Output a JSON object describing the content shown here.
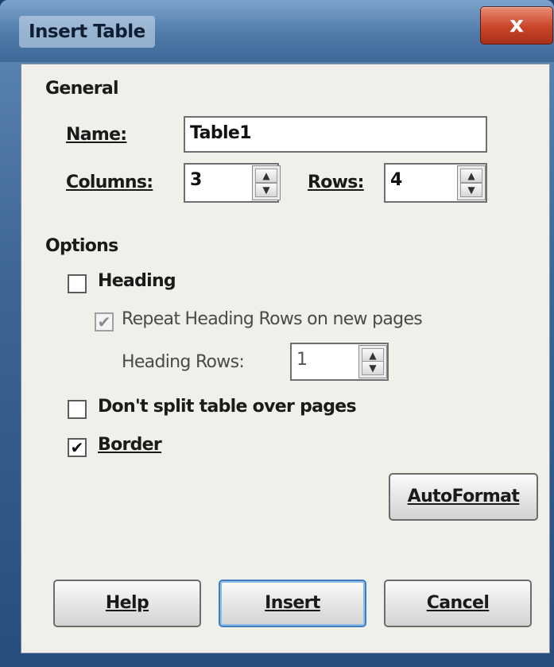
{
  "window": {
    "title": "Insert Table",
    "close_glyph": "x"
  },
  "general": {
    "heading": "General",
    "name_label": "Name:",
    "name_value": "Table1",
    "columns_label": "Columns:",
    "columns_value": "3",
    "rows_label": "Rows:",
    "rows_value": "4"
  },
  "options": {
    "heading": "Options",
    "heading_checkbox_label": "Heading",
    "heading_checked": false,
    "repeat_label": "Repeat Heading Rows on new pages",
    "repeat_checked": true,
    "repeat_enabled": false,
    "heading_rows_label": "Heading Rows:",
    "heading_rows_value": "1",
    "dont_split_label": "Don't split table over pages",
    "dont_split_checked": false,
    "border_label": "Border",
    "border_checked": true
  },
  "buttons": {
    "autoformat": "AutoFormat",
    "help": "Help",
    "insert": "Insert",
    "cancel": "Cancel"
  },
  "glyphs": {
    "check": "✔",
    "spin_up": "▲",
    "spin_down": "▼"
  }
}
